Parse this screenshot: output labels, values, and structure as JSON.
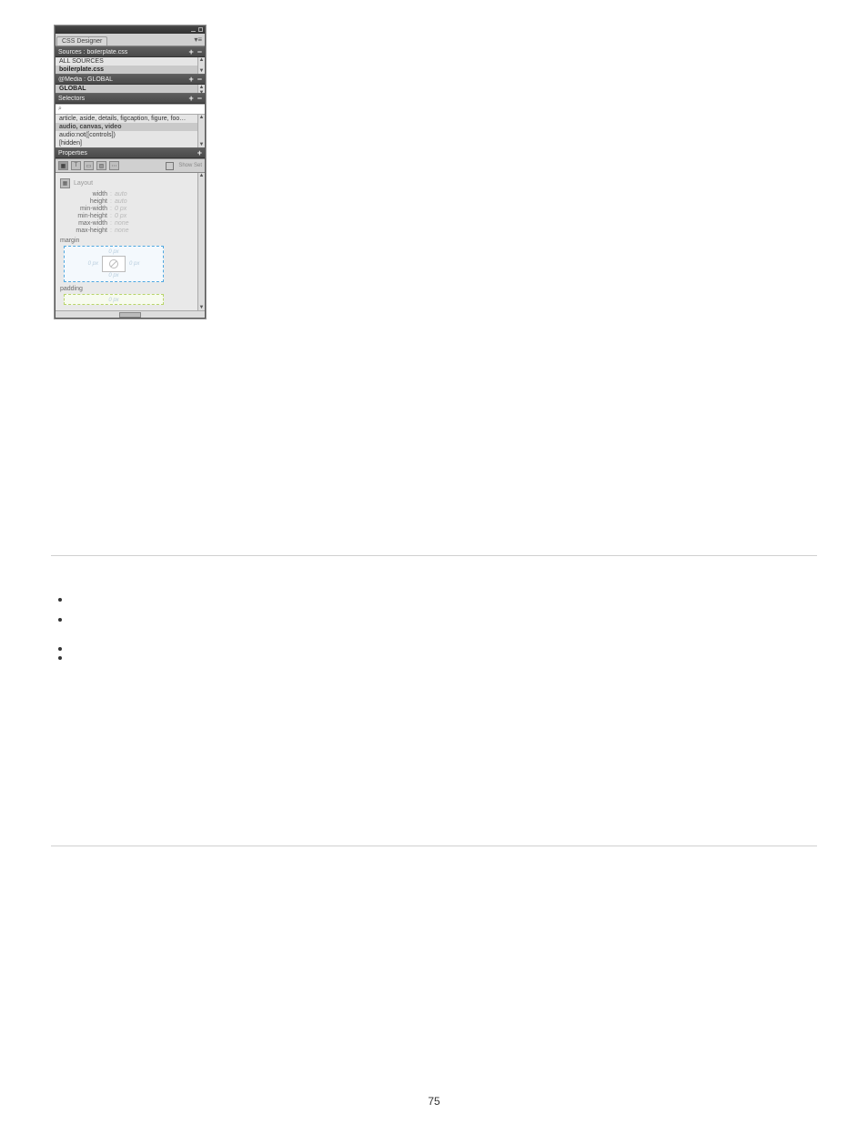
{
  "page_number": "75",
  "panel": {
    "tab_title": "CSS Designer",
    "menu_glyph": "▾≡",
    "sources": {
      "header": "Sources : boilerplate.css",
      "items": [
        "ALL SOURCES",
        "boilerplate.css"
      ],
      "selected_index": 1
    },
    "media": {
      "header": "@Media : GLOBAL",
      "items": [
        "GLOBAL"
      ],
      "selected_index": 0
    },
    "selectors": {
      "header": "Selectors",
      "search_placeholder": "",
      "items": [
        "article, aside, details, figcaption, figure, foo…",
        "audio, canvas, video",
        "audio:not([controls])",
        "[hidden]"
      ],
      "selected_index": 1
    },
    "properties": {
      "header": "Properties",
      "show_set_label": "Show Set",
      "category_label": "Layout",
      "layout_rows": [
        {
          "k": "width",
          "v": "auto"
        },
        {
          "k": "height",
          "v": "auto"
        },
        {
          "k": "min-width",
          "v": "0 px"
        },
        {
          "k": "min-height",
          "v": "0 px"
        },
        {
          "k": "max-width",
          "v": "none"
        },
        {
          "k": "max-height",
          "v": "none"
        }
      ],
      "margin_label": "margin",
      "margin_values": {
        "top": "0 px",
        "right": "0 px",
        "bottom": "0 px",
        "left": "0 px"
      },
      "padding_label": "padding",
      "padding_values": {
        "top": "0 px"
      }
    }
  }
}
